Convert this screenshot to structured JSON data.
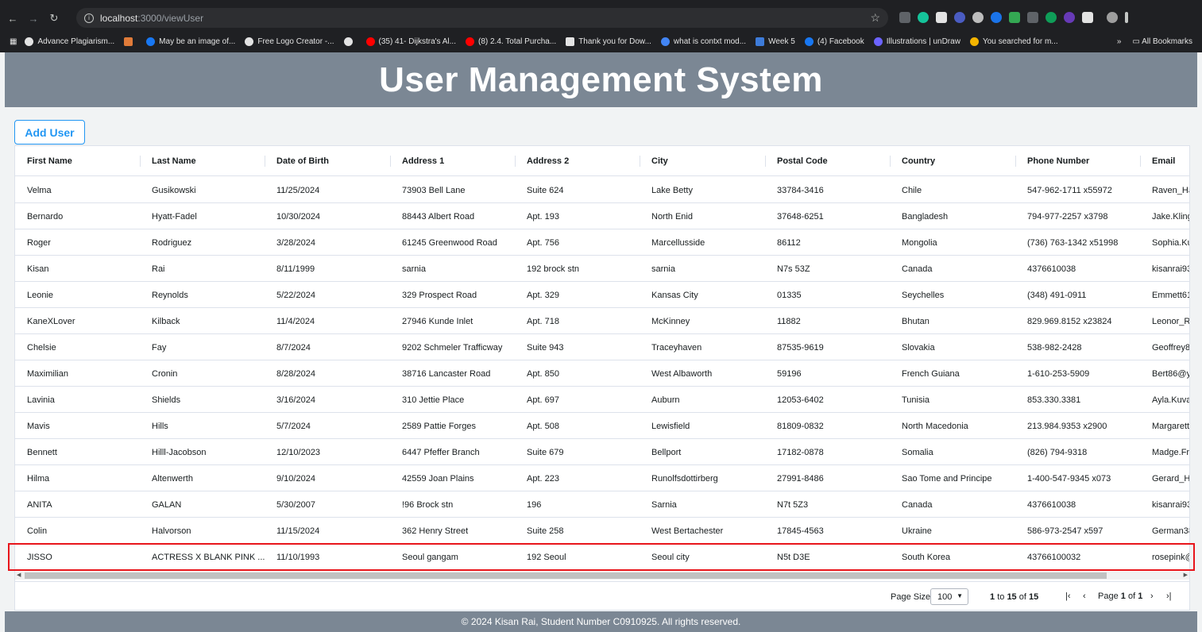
{
  "browser": {
    "url_host": "localhost",
    "url_path": ":3000/viewUser",
    "bookmarks": [
      {
        "label": "Advance Plagiarism...",
        "color": "#e3e3e3"
      },
      {
        "label": "",
        "color": "#e07b39"
      },
      {
        "label": "May be an image of...",
        "color": "#1877f2"
      },
      {
        "label": "Free Logo Creator -...",
        "color": "#e3e3e3"
      },
      {
        "label": "",
        "color": "#e3e3e3"
      },
      {
        "label": "(35) 41- Dijkstra's Al...",
        "color": "#ff0000"
      },
      {
        "label": "(8) 2.4. Total Purcha...",
        "color": "#ff0000"
      },
      {
        "label": "Thank you for Dow...",
        "color": "#e3e3e3"
      },
      {
        "label": "what is contxt mod...",
        "color": "#4285f4"
      },
      {
        "label": "Week 5",
        "color": "#3d7bd9"
      },
      {
        "label": "(4) Facebook",
        "color": "#1877f2"
      },
      {
        "label": "Illustrations | unDraw",
        "color": "#6c63ff"
      },
      {
        "label": "You searched for m...",
        "color": "#f4b400"
      }
    ],
    "all_bookmarks": "All Bookmarks",
    "more": "»"
  },
  "header": {
    "title": "User Management System"
  },
  "toolbar": {
    "add_user_label": "Add User"
  },
  "grid": {
    "columns": [
      "First Name",
      "Last Name",
      "Date of Birth",
      "Address 1",
      "Address 2",
      "City",
      "Postal Code",
      "Country",
      "Phone Number",
      "Email"
    ],
    "rows": [
      [
        "Velma",
        "Gusikowski",
        "11/25/2024",
        "73903 Bell Lane",
        "Suite 624",
        "Lake Betty",
        "33784-3416",
        "Chile",
        "547-962-1711 x55972",
        "Raven_Ha"
      ],
      [
        "Bernardo",
        "Hyatt-Fadel",
        "10/30/2024",
        "88443 Albert Road",
        "Apt. 193",
        "North Enid",
        "37648-6251",
        "Bangladesh",
        "794-977-2257 x3798",
        "Jake.Kling"
      ],
      [
        "Roger",
        "Rodriguez",
        "3/28/2024",
        "61245 Greenwood Road",
        "Apt. 756",
        "Marcellusside",
        "86112",
        "Mongolia",
        "(736) 763-1342 x51998",
        "Sophia.Ku"
      ],
      [
        "Kisan",
        "Rai",
        "8/11/1999",
        "sarnia",
        "192 brock stn",
        "sarnia",
        "N7s 53Z",
        "Canada",
        "4376610038",
        "kisanrai93"
      ],
      [
        "Leonie",
        "Reynolds",
        "5/22/2024",
        "329 Prospect Road",
        "Apt. 329",
        "Kansas City",
        "01335",
        "Seychelles",
        "(348) 491-0911",
        "Emmett61"
      ],
      [
        "KaneXLover",
        "Kilback",
        "11/4/2024",
        "27946 Kunde Inlet",
        "Apt. 718",
        "McKinney",
        "11882",
        "Bhutan",
        "829.969.8152 x23824",
        "Leonor_Ri"
      ],
      [
        "Chelsie",
        "Fay",
        "8/7/2024",
        "9202 Schmeler Trafficway",
        "Suite 943",
        "Traceyhaven",
        "87535-9619",
        "Slovakia",
        "538-982-2428",
        "Geoffrey8"
      ],
      [
        "Maximilian",
        "Cronin",
        "8/28/2024",
        "38716 Lancaster Road",
        "Apt. 850",
        "West Albaworth",
        "59196",
        "French Guiana",
        "1-610-253-5909",
        "Bert86@y"
      ],
      [
        "Lavinia",
        "Shields",
        "3/16/2024",
        "310 Jettie Place",
        "Apt. 697",
        "Auburn",
        "12053-6402",
        "Tunisia",
        "853.330.3381",
        "Ayla.Kuva"
      ],
      [
        "Mavis",
        "Hills",
        "5/7/2024",
        "2589 Pattie Forges",
        "Apt. 508",
        "Lewisfield",
        "81809-0832",
        "North Macedonia",
        "213.984.9353 x2900",
        "Margarett"
      ],
      [
        "Bennett",
        "Hilll-Jacobson",
        "12/10/2023",
        "6447 Pfeffer Branch",
        "Suite 679",
        "Bellport",
        "17182-0878",
        "Somalia",
        "(826) 794-9318",
        "Madge.Fr"
      ],
      [
        "Hilma",
        "Altenwerth",
        "9/10/2024",
        "42559 Joan Plains",
        "Apt. 223",
        "Runolfsdottirberg",
        "27991-8486",
        "Sao Tome and Principe",
        "1-400-547-9345 x073",
        "Gerard_H"
      ],
      [
        "ANITA",
        "GALAN",
        "5/30/2007",
        "!96 Brock stn",
        "196",
        "Sarnia",
        "N7t 5Z3",
        "Canada",
        "4376610038",
        "kisanrai93"
      ],
      [
        "Colin",
        "Halvorson",
        "11/15/2024",
        "362 Henry Street",
        "Suite 258",
        "West Bertachester",
        "17845-4563",
        "Ukraine",
        "586-973-2547 x597",
        "German38"
      ],
      [
        "JISSO",
        "ACTRESS X BLANK PINK ...",
        "11/10/1993",
        "Seoul gangam",
        "192 Seoul",
        "Seoul city",
        "N5t D3E",
        "South Korea",
        "43766100032",
        "rosepink@"
      ]
    ],
    "selected_row_index": 14,
    "highlight_color": "#e8151b"
  },
  "paging": {
    "page_size_label": "Page Size:",
    "page_size_value": "100",
    "range_from": "1",
    "to_label": "to",
    "range_to": "15",
    "of_label": "of",
    "total": "15",
    "page_label": "Page",
    "page_current": "1",
    "page_total": "1",
    "first": "|‹",
    "prev": "‹",
    "next": "›",
    "last": "›|"
  },
  "footer": {
    "text": "© 2024 Kisan Rai, Student Number C0910925. All rights reserved."
  }
}
